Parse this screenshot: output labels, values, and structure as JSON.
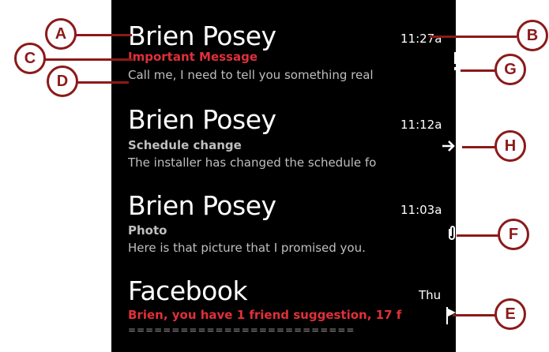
{
  "messages": [
    {
      "sender": "Brien Posey",
      "subject": "Important Message",
      "preview": "Call me, I need to tell you something real",
      "time": "11:27a",
      "status_icon": "important-icon",
      "subject_color": "#e0303a"
    },
    {
      "sender": "Brien Posey",
      "subject": "Schedule change",
      "preview": "The installer has changed the schedule fo",
      "time": "11:12a",
      "status_icon": "forward-arrow-icon"
    },
    {
      "sender": "Brien Posey",
      "subject": "Photo",
      "preview": "Here is that picture that I promised you.",
      "time": "11:03a",
      "status_icon": "paperclip-icon"
    },
    {
      "sender": "Facebook",
      "preview": "Brien, you have 1 friend suggestion, 17 f",
      "separator": "==========================",
      "time": "Thu",
      "status_icon": "flag-icon",
      "preview_color": "#e0303a"
    }
  ],
  "callouts": {
    "a": "A",
    "b": "B",
    "c": "C",
    "d": "D",
    "e": "E",
    "f": "F",
    "g": "G",
    "h": "H"
  },
  "colors": {
    "background": "#000000",
    "accent": "#e0303a",
    "callout": "#8b1a1a"
  }
}
